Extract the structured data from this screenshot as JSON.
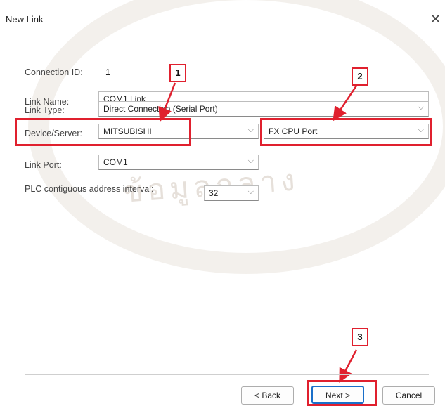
{
  "dialog": {
    "title": "New Link",
    "close_glyph": "✕"
  },
  "form": {
    "connection_id": {
      "label": "Connection ID:",
      "value": "1"
    },
    "link_name": {
      "label": "Link Name:",
      "value": "COM1 Link"
    },
    "link_type": {
      "label": "Link Type:",
      "value": "Direct Connection (Serial Port)"
    },
    "device_server": {
      "label": "Device/Server:",
      "value": "MITSUBISHI"
    },
    "device_model": {
      "value": "FX CPU Port"
    },
    "link_port": {
      "label": "Link Port:",
      "value": "COM1"
    },
    "address_interval": {
      "label": "PLC contiguous address interval:",
      "value": "32"
    }
  },
  "buttons": {
    "back": "< Back",
    "next": "Next >",
    "cancel": "Cancel"
  },
  "annotations": {
    "step1": "1",
    "step2": "2",
    "step3": "3"
  },
  "watermark": {
    "text": "ข้อมูลกลาง"
  },
  "colors": {
    "highlight": "#e0202e",
    "primary_border": "#1a6fc9"
  },
  "icons": {
    "dropdown": "chevron-down-icon",
    "close": "close-icon"
  }
}
